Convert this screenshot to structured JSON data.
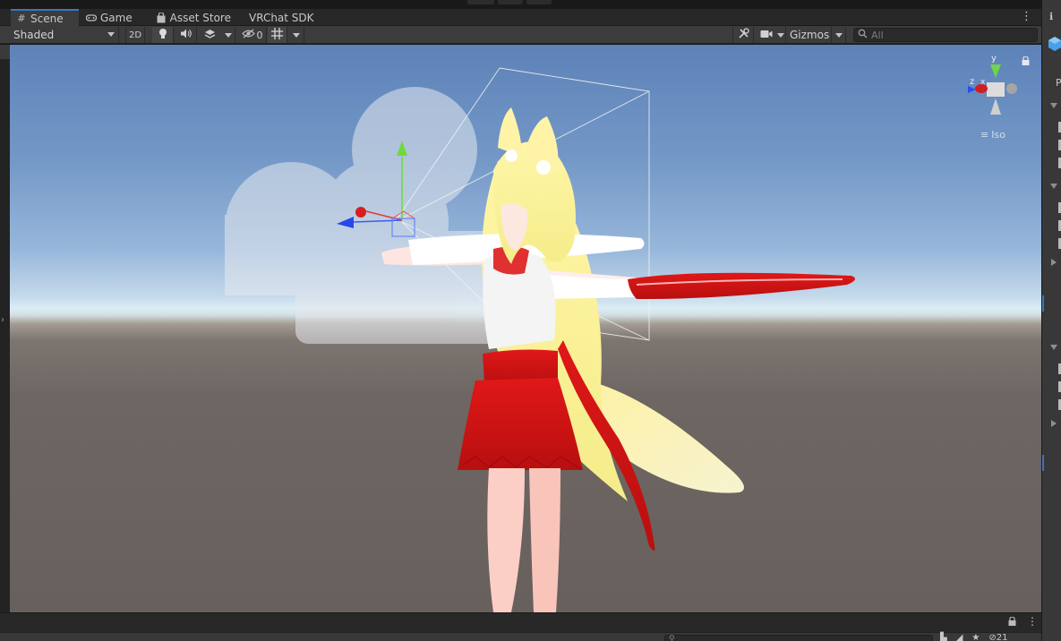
{
  "tabs": [
    {
      "label": "Scene",
      "icon": "grid-icon",
      "active": true
    },
    {
      "label": "Game",
      "icon": "gamepad-icon",
      "active": false
    },
    {
      "label": "Asset Store",
      "icon": "shopping-bag-icon",
      "active": false
    },
    {
      "label": "VRChat SDK",
      "icon": "",
      "active": false
    }
  ],
  "toolbar": {
    "shading_mode": "Shaded",
    "mode_2d": "2D",
    "hidden_count": "0",
    "gizmos_label": "Gizmos",
    "search_placeholder": "All"
  },
  "scene_view": {
    "orientation_gizmo": {
      "x_label": "x",
      "y_label": "y",
      "z_label": "z"
    },
    "projection_label": "Iso"
  },
  "colors": {
    "accent": "#3a79bb",
    "panel_bg": "#3c3c3c",
    "tab_bg": "#282828"
  },
  "bottom_bar": {
    "search_placeholder": "",
    "visibility_count": "21"
  }
}
